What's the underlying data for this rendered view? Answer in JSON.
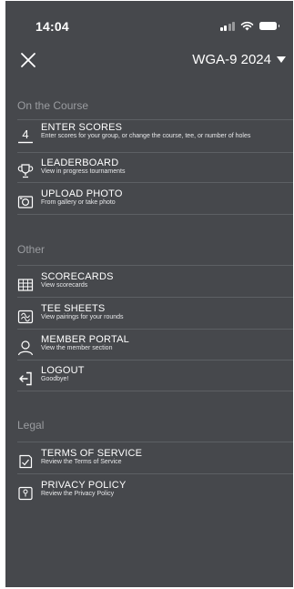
{
  "status_bar": {
    "time": "14:04"
  },
  "header": {
    "tournament": "WGA-9 2024"
  },
  "sections": [
    {
      "title": "On the Course",
      "items": [
        {
          "title": "ENTER SCORES",
          "description": "Enter scores for your group, or change the course, tee, or number of holes",
          "icon": "scorecard-4-icon"
        },
        {
          "title": "LEADERBOARD",
          "description": "View in progress tournaments",
          "icon": "trophy-icon"
        },
        {
          "title": "UPLOAD PHOTO",
          "description": "From gallery or take photo",
          "icon": "camera-icon"
        }
      ]
    },
    {
      "title": "Other",
      "items": [
        {
          "title": "SCORECARDS",
          "description": "View scorecards",
          "icon": "grid-icon"
        },
        {
          "title": "TEE SHEETS",
          "description": "View pairings for your rounds",
          "icon": "tee-sheet-icon"
        },
        {
          "title": "MEMBER PORTAL",
          "description": "View the member section",
          "icon": "user-icon"
        },
        {
          "title": "LOGOUT",
          "description": "Goodbye!",
          "icon": "logout-icon"
        }
      ]
    },
    {
      "title": "Legal",
      "items": [
        {
          "title": "TERMS OF SERVICE",
          "description": "Review the Terms of Service",
          "icon": "terms-icon"
        },
        {
          "title": "PRIVACY POLICY",
          "description": "Review the Privacy Policy",
          "icon": "privacy-icon"
        }
      ]
    }
  ]
}
